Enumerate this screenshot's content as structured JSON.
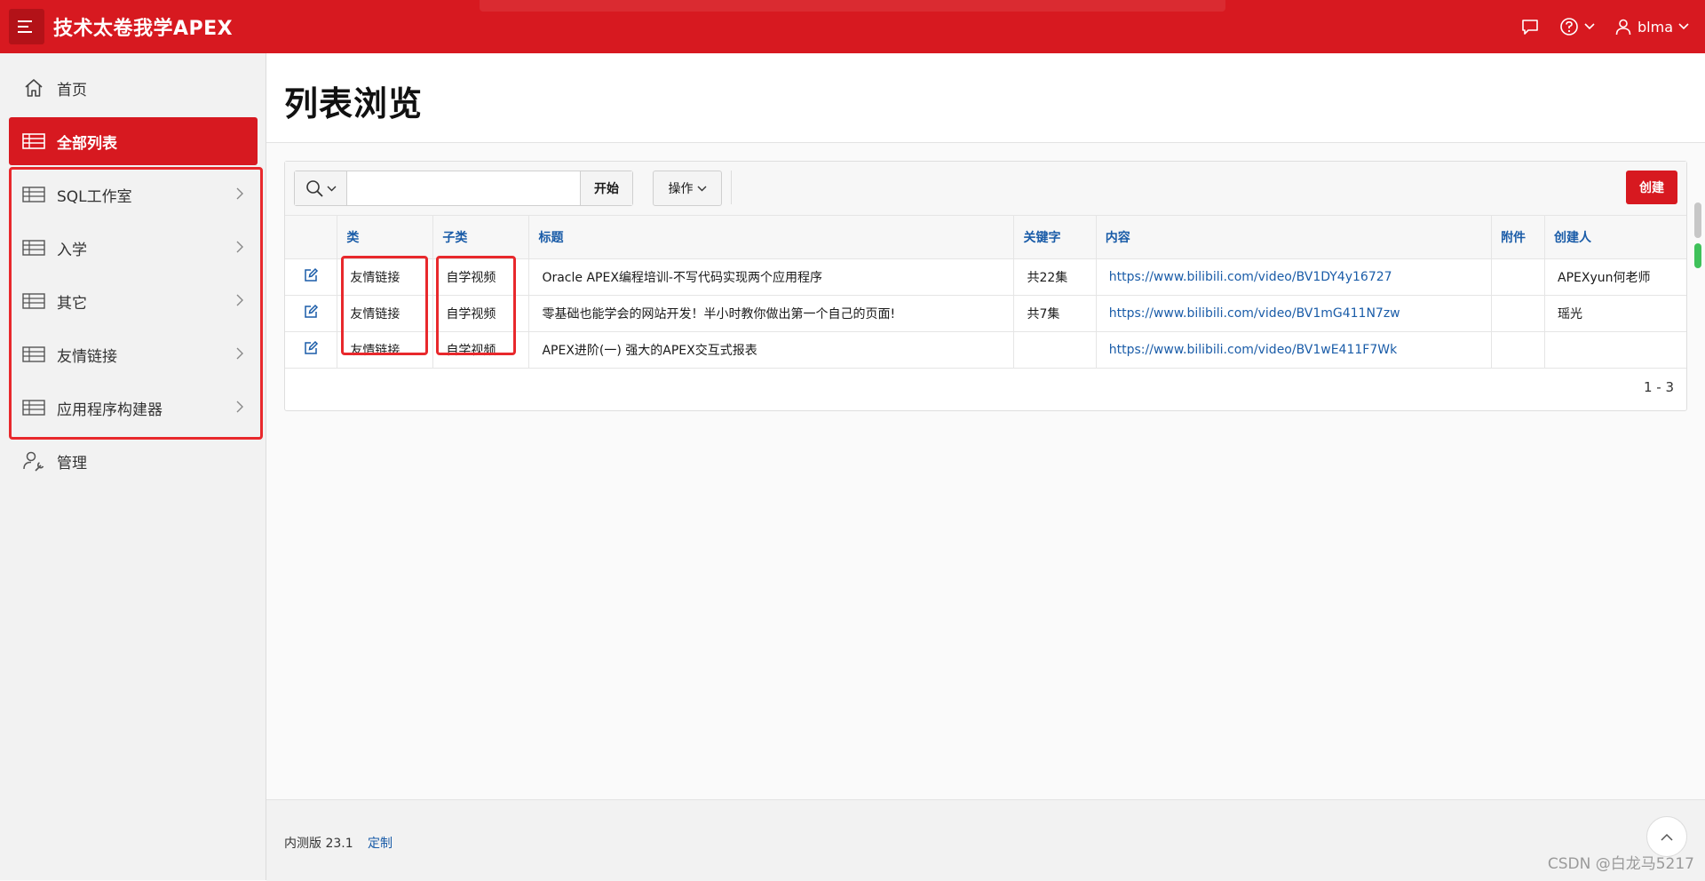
{
  "header": {
    "app_title": "技术太卷我学APEX",
    "user": "blma",
    "icons": [
      "menu-icon",
      "chat-icon",
      "help-icon",
      "user-icon"
    ]
  },
  "sidebar": {
    "items": [
      {
        "label": "首页",
        "icon": "home-icon"
      },
      {
        "label": "全部列表",
        "icon": "table-icon"
      },
      {
        "label": "SQL工作室",
        "icon": "table-icon"
      },
      {
        "label": "入学",
        "icon": "table-icon"
      },
      {
        "label": "其它",
        "icon": "table-icon"
      },
      {
        "label": "友情链接",
        "icon": "table-icon"
      },
      {
        "label": "应用程序构建器",
        "icon": "table-icon"
      },
      {
        "label": "管理",
        "icon": "user-admin-icon"
      }
    ]
  },
  "page": {
    "title": "列表浏览"
  },
  "toolbar": {
    "search_placeholder": "",
    "go_label": "开始",
    "actions_label": "操作",
    "create_label": "创建"
  },
  "table": {
    "headers": [
      "类",
      "子类",
      "标题",
      "关键字",
      "内容",
      "附件",
      "创建人"
    ],
    "rows": [
      [
        "友情链接",
        "自学视频",
        "Oracle APEX编程培训-不写代码实现两个应用程序",
        "共22集",
        "https://www.bilibili.com/video/BV1DY4y16727",
        "",
        "APEXyun何老师"
      ],
      [
        "友情链接",
        "自学视频",
        "零基础也能学会的网站开发！半小时教你做出第一个自己的页面!",
        "共7集",
        "https://www.bilibili.com/video/BV1mG411N7zw",
        "",
        "瑶光"
      ],
      [
        "友情链接",
        "自学视频",
        "APEX进阶(一) 强大的APEX交互式报表",
        "",
        "https://www.bilibili.com/video/BV1wE411F7Wk",
        "",
        ""
      ]
    ],
    "pagination": "1 - 3"
  },
  "footer": {
    "version": "内测版 23.1",
    "customize": "定制"
  },
  "watermark": "CSDN @白龙马5217",
  "colors": {
    "brand": "#d71920",
    "link": "#1a5ca8",
    "highlight_box": "#e8282c"
  }
}
